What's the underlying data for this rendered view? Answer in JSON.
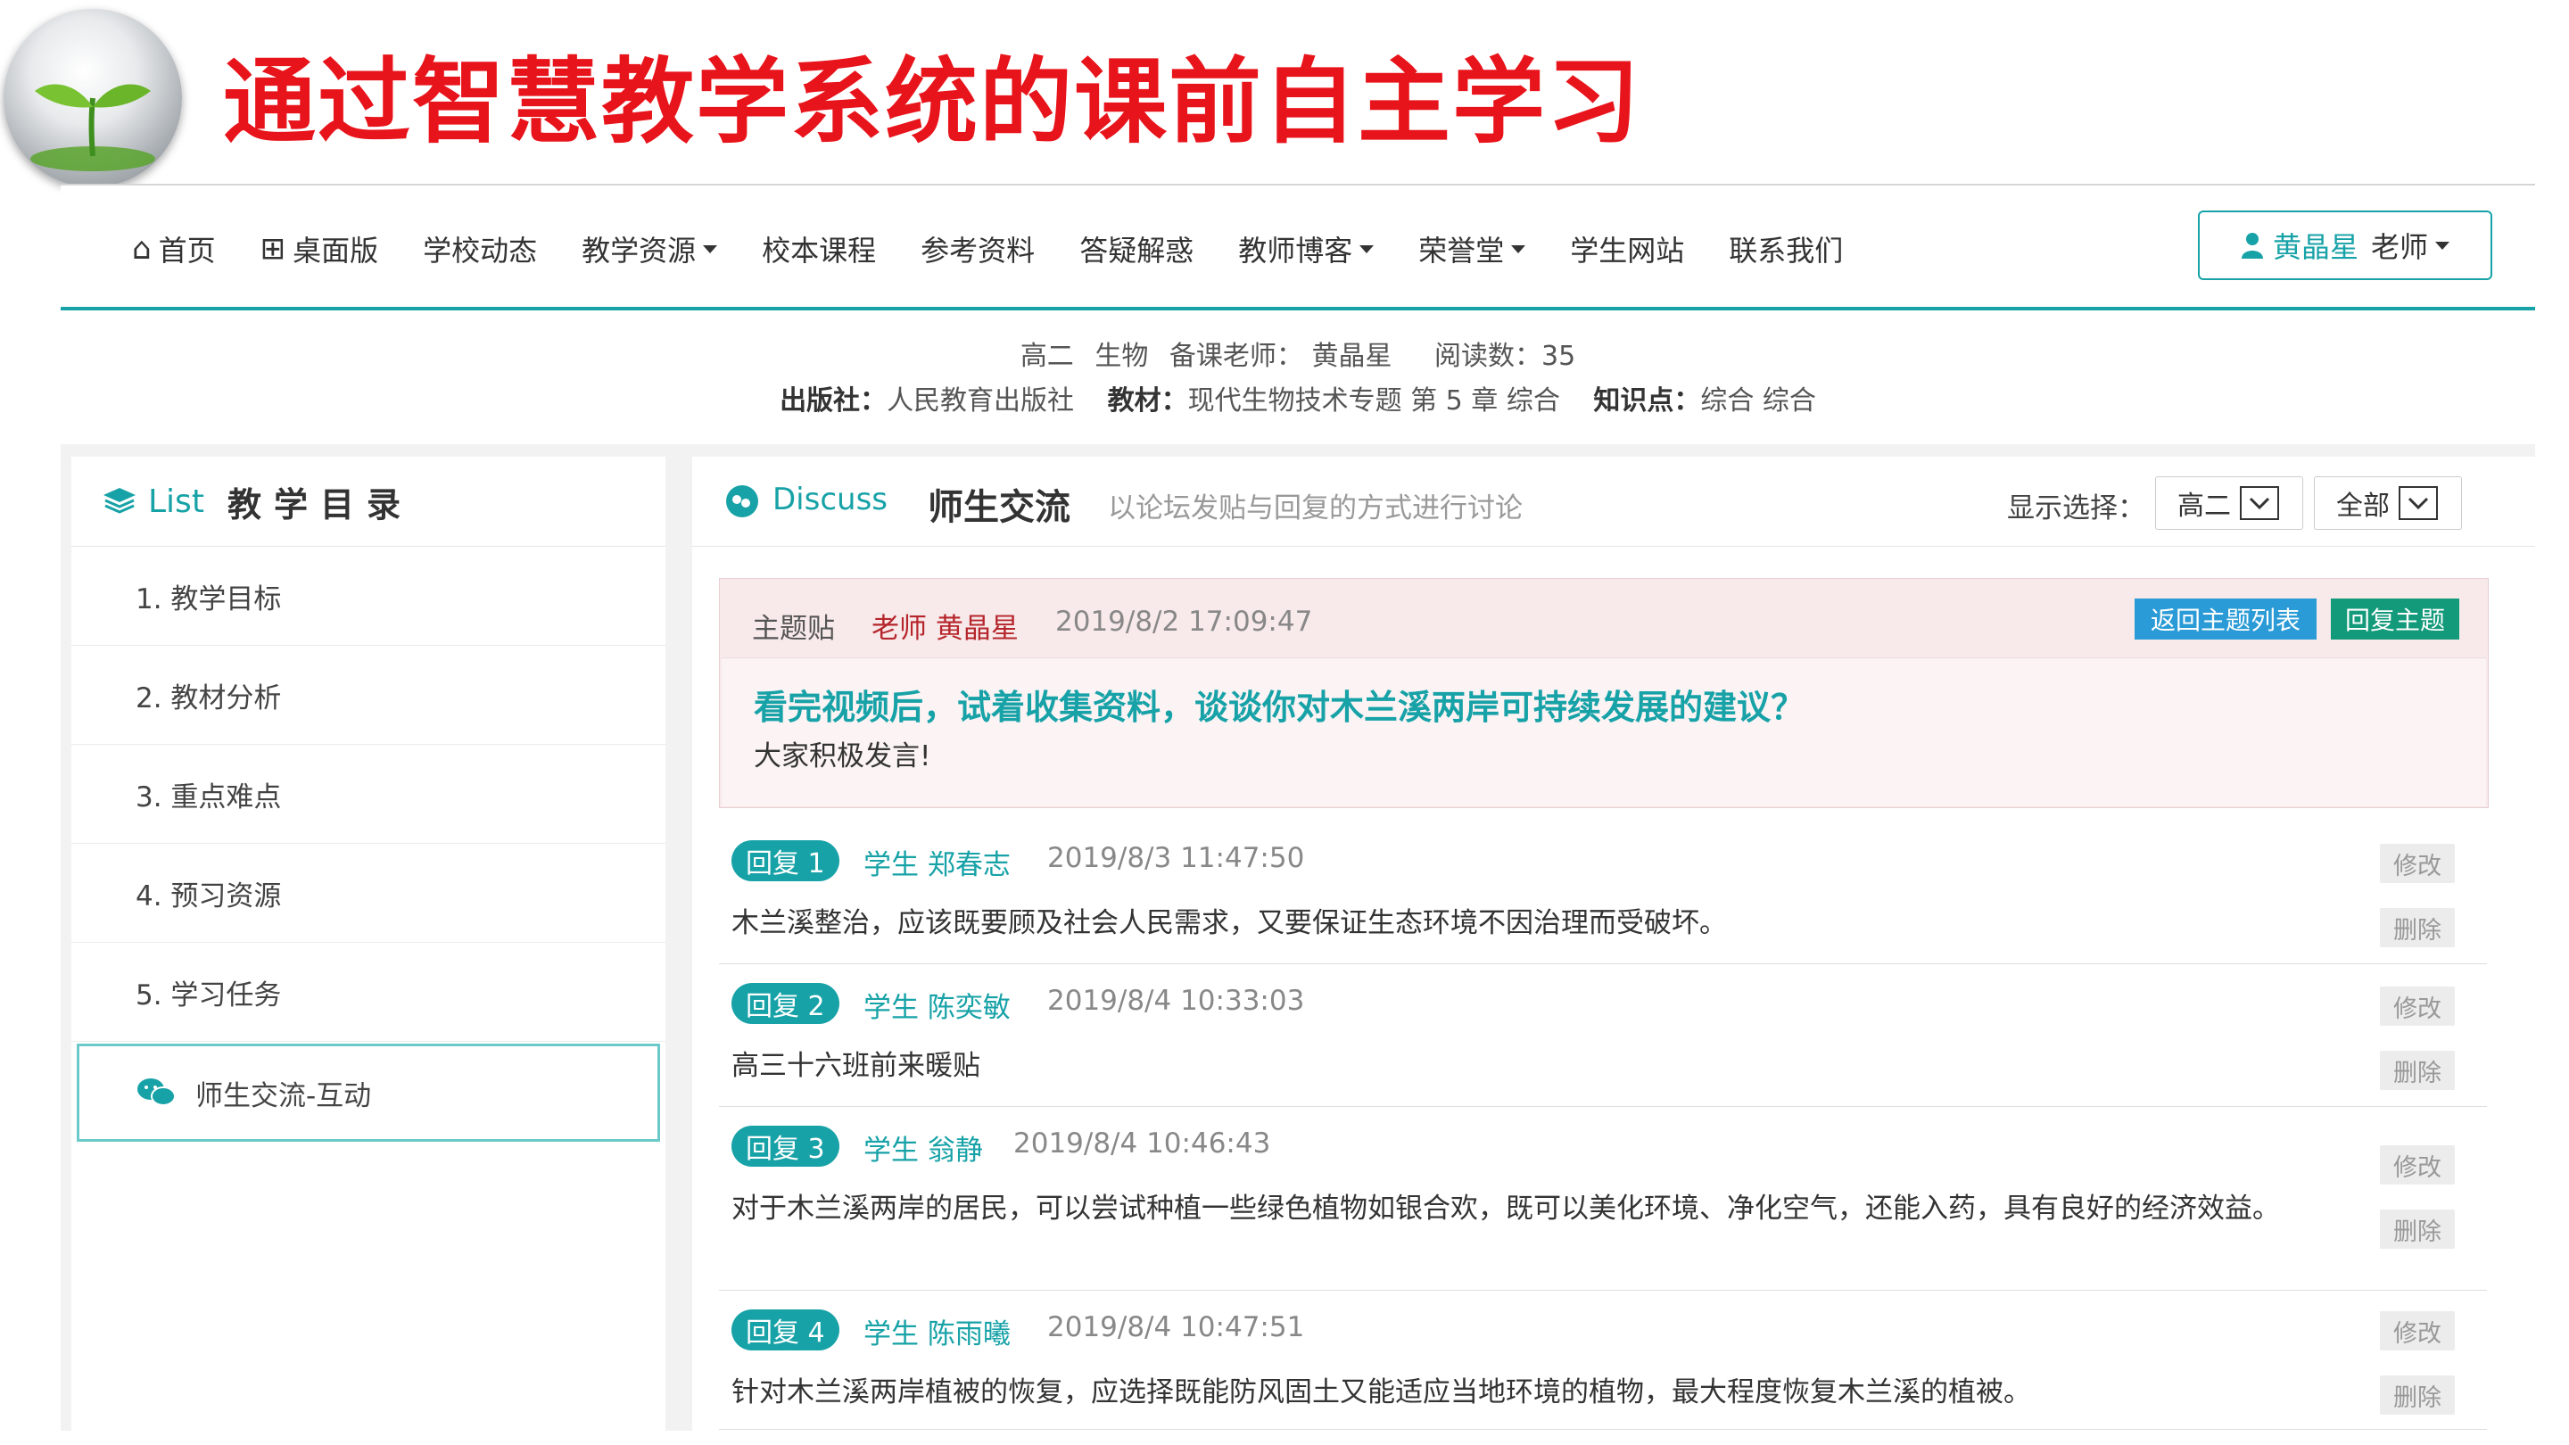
{
  "slide": {
    "title": "通过智慧教学系统的课前自主学习"
  },
  "nav": {
    "items": [
      {
        "label": "首页",
        "icon": "home-icon",
        "glyph": "⌂",
        "dropdown": false
      },
      {
        "label": "桌面版",
        "icon": "grid-icon",
        "glyph": "⊞",
        "dropdown": false
      },
      {
        "label": "学校动态",
        "dropdown": false
      },
      {
        "label": "教学资源",
        "dropdown": true
      },
      {
        "label": "校本课程",
        "dropdown": false
      },
      {
        "label": "参考资料",
        "dropdown": false
      },
      {
        "label": "答疑解惑",
        "dropdown": false
      },
      {
        "label": "教师博客",
        "dropdown": true
      },
      {
        "label": "荣誉堂",
        "dropdown": true
      },
      {
        "label": "学生网站",
        "dropdown": false
      },
      {
        "label": "联系我们",
        "dropdown": false
      }
    ],
    "user": {
      "name": "黄晶星",
      "role": "老师"
    }
  },
  "info": {
    "grade": "高二",
    "subject": "生物",
    "teacher_label": "备课老师：",
    "teacher": "黄晶星",
    "reads_label": "阅读数：",
    "reads": "35",
    "publisher_label": "出版社：",
    "publisher": "人民教育出版社",
    "textbook_label": "教材：",
    "textbook": "现代生物技术专题 第 5 章 综合",
    "knowledge_label": "知识点：",
    "knowledge": "综合 综合"
  },
  "sidebar": {
    "title_en": "List",
    "title_cn": "教学目录",
    "items": [
      {
        "label": "1. 教学目标"
      },
      {
        "label": "2. 教材分析"
      },
      {
        "label": "3. 重点难点"
      },
      {
        "label": "4. 预习资源"
      },
      {
        "label": "5. 学习任务"
      },
      {
        "label": "师生交流-互动",
        "active": true
      }
    ]
  },
  "discuss": {
    "title_en": "Discuss",
    "title_cn": "师生交流",
    "subtitle": "以论坛发贴与回复的方式进行讨论",
    "filter_label": "显示选择：",
    "filter_grade": "高二",
    "filter_scope": "全部",
    "topic": {
      "label": "主题贴",
      "author": "老师 黄晶星",
      "time": "2019/8/2 17:09:47",
      "back_label": "返回主题列表",
      "reply_label": "回复主题",
      "title": "看完视频后，试着收集资料，谈谈你对木兰溪两岸可持续发展的建议？",
      "text": "大家积极发言!"
    },
    "edit_label": "修改",
    "delete_label": "删除",
    "replies": [
      {
        "badge": "回复 1",
        "author": "学生 郑春志",
        "time": "2019/8/3 11:47:50",
        "text": "木兰溪整治，应该既要顾及社会人民需求，又要保证生态环境不因治理而受破坏。"
      },
      {
        "badge": "回复 2",
        "author": "学生 陈奕敏",
        "time": "2019/8/4 10:33:03",
        "text": "高三十六班前来暖贴"
      },
      {
        "badge": "回复 3",
        "author": "学生 翁静",
        "time": "2019/8/4 10:46:43",
        "text": "对于木兰溪两岸的居民，可以尝试种植一些绿色植物如银合欢，既可以美化环境、净化空气，还能入药，具有良好的经济效益。"
      },
      {
        "badge": "回复 4",
        "author": "学生 陈雨曦",
        "time": "2019/8/4 10:47:51",
        "text": "针对木兰溪两岸植被的恢复，应选择既能防风固土又能适应当地环境的植物，最大程度恢复木兰溪的植被。"
      }
    ]
  },
  "colors": {
    "accent": "#17a2a7",
    "title_red": "#e8141b",
    "topic_bg": "#f8e9ea"
  }
}
